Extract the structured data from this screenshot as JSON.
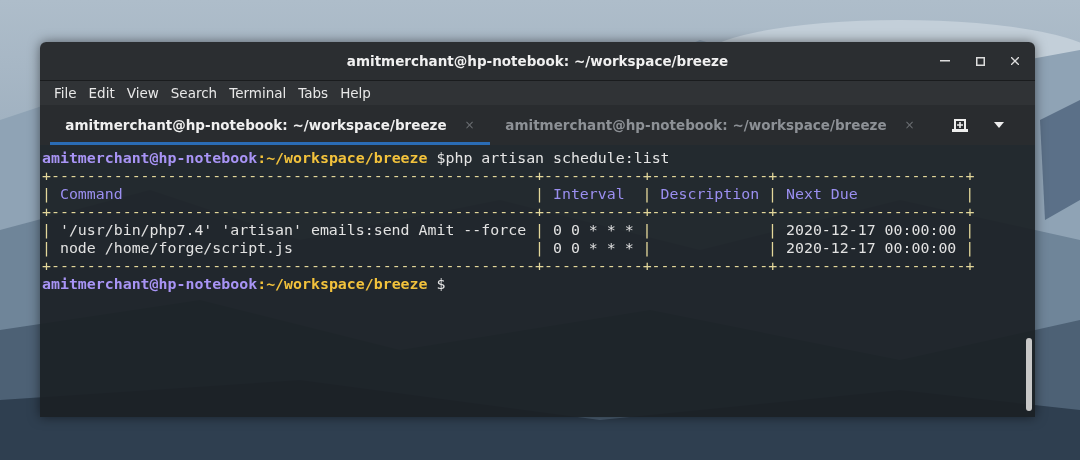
{
  "window": {
    "title": "amitmerchant@hp-notebook: ~/workspace/breeze"
  },
  "menu": [
    "File",
    "Edit",
    "View",
    "Search",
    "Terminal",
    "Tabs",
    "Help"
  ],
  "tabs": [
    {
      "label": "amitmerchant@hp-notebook: ~/workspace/breeze",
      "close": "×",
      "selected": true
    },
    {
      "label": "amitmerchant@hp-notebook: ~/workspace/breeze",
      "close": "×",
      "selected": false
    }
  ],
  "terminal": {
    "lines": [
      {
        "kind": "prompt",
        "user_host": "amitmerchant@hp-notebook",
        "path": ":~/workspace/breeze",
        "symbol": "$",
        "command": "php artisan schedule:list"
      },
      {
        "kind": "border",
        "text": "+------------------------------------------------------+-----------+-------------+---------------------+"
      },
      {
        "kind": "header",
        "cells": [
          "Command",
          "Interval",
          "Description",
          "Next Due"
        ]
      },
      {
        "kind": "border",
        "text": "+------------------------------------------------------+-----------+-------------+---------------------+"
      },
      {
        "kind": "row",
        "cells": [
          "'/usr/bin/php7.4' 'artisan' emails:send Amit --force",
          "0 0 * * *",
          "",
          "2020-12-17 00:00:00"
        ]
      },
      {
        "kind": "row",
        "cells": [
          "node /home/forge/script.js",
          "0 0 * * *",
          "",
          "2020-12-17 00:00:00"
        ]
      },
      {
        "kind": "border",
        "text": "+------------------------------------------------------+-----------+-------------+---------------------+"
      },
      {
        "kind": "prompt",
        "user_host": "amitmerchant@hp-notebook",
        "path": ":~/workspace/breeze",
        "symbol": "$"
      }
    ],
    "separator": "|"
  }
}
